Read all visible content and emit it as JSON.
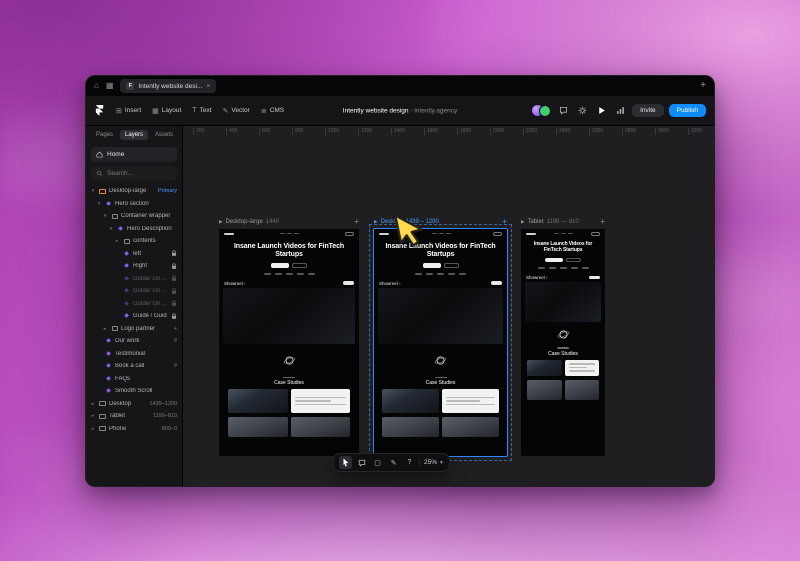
{
  "browser": {
    "tab_title": "Intently website desi...",
    "close_label": "×",
    "new_tab_label": "+"
  },
  "toolbar": {
    "menu": [
      {
        "label": "Insert",
        "icon": "⊞"
      },
      {
        "label": "Layout",
        "icon": "▦"
      },
      {
        "label": "Text",
        "icon": "T"
      },
      {
        "label": "Vector",
        "icon": "✎"
      },
      {
        "label": "CMS",
        "icon": "≣"
      }
    ],
    "title": "Intently website design",
    "separator": "-",
    "subtitle": "intently.agency",
    "invite_label": "Invite",
    "publish_label": "Publish",
    "accent_color": "#0e8cff"
  },
  "sidebar": {
    "tabs": [
      "Pages",
      "Layers",
      "Assets"
    ],
    "active_tab": "Layers",
    "home_label": "Home",
    "search_placeholder": "Search...",
    "tree": [
      {
        "depth": 0,
        "chevron": "down",
        "icon": "breakpoint",
        "primary": true,
        "label": "Desktop-large",
        "right": "Primary",
        "right_accent": true
      },
      {
        "depth": 1,
        "chevron": "down",
        "icon": "component",
        "label": "Hero section"
      },
      {
        "depth": 2,
        "chevron": "down",
        "icon": "frame",
        "label": "Container wrapper"
      },
      {
        "depth": 3,
        "chevron": "down",
        "icon": "component",
        "label": "Hero Description"
      },
      {
        "depth": 4,
        "chevron": "right",
        "icon": "frame",
        "label": "contents"
      },
      {
        "depth": 4,
        "chevron": "",
        "icon": "component",
        "label": "left",
        "lock": true
      },
      {
        "depth": 4,
        "chevron": "",
        "icon": "component",
        "label": "Right",
        "lock": true
      },
      {
        "depth": 4,
        "chevron": "",
        "icon": "component",
        "label": "Guide/ Grid Dot 1",
        "dim": true,
        "lock": true
      },
      {
        "depth": 4,
        "chevron": "",
        "icon": "component",
        "label": "Guide/ Grid Dot 1",
        "dim": true,
        "lock": true
      },
      {
        "depth": 4,
        "chevron": "",
        "icon": "component",
        "label": "Guide/ Grid Dot 1",
        "dim": true,
        "lock": true
      },
      {
        "depth": 4,
        "chevron": "",
        "icon": "component",
        "label": "Guide / Guid",
        "lock": true
      },
      {
        "depth": 2,
        "chevron": "right",
        "icon": "frame",
        "label": "Logo partner",
        "right": "+"
      },
      {
        "depth": 1,
        "chevron": "",
        "icon": "component",
        "label": "Our work",
        "right": "#"
      },
      {
        "depth": 1,
        "chevron": "",
        "icon": "component",
        "label": "Testimonial"
      },
      {
        "depth": 1,
        "chevron": "",
        "icon": "component",
        "label": "Book a call",
        "right": "#"
      },
      {
        "depth": 1,
        "chevron": "",
        "icon": "component",
        "label": "FAQs"
      },
      {
        "depth": 1,
        "chevron": "",
        "icon": "component",
        "label": "Smooth Scroll"
      },
      {
        "depth": 0,
        "chevron": "right",
        "icon": "breakpoint",
        "label": "Desktop",
        "right": "1439–1200"
      },
      {
        "depth": 0,
        "chevron": "right",
        "icon": "breakpoint",
        "label": "Tablet",
        "right": "1199–810"
      },
      {
        "depth": 0,
        "chevron": "right",
        "icon": "breakpoint",
        "label": "Phone",
        "right": "809–0"
      }
    ]
  },
  "canvas": {
    "ruler_labels": [
      "200",
      "400",
      "600",
      "800",
      "1000",
      "1200",
      "1400",
      "1600",
      "1800",
      "2000",
      "2200",
      "2400",
      "2600",
      "2800",
      "3000",
      "3200"
    ],
    "frames": [
      {
        "name": "Desktop-large",
        "size": "1440",
        "selected": false,
        "add_label": "+"
      },
      {
        "name": "Desktop",
        "size": "1439 – 1200",
        "selected": true,
        "add_label": "+"
      },
      {
        "name": "Tablet",
        "size": "1199 — 810",
        "selected": false,
        "add_label": "+"
      }
    ],
    "site": {
      "heading": "Insane Launch Videos for FinTech Startups",
      "showreel_label": "Showreel ›",
      "case_studies_label": "Case Studies"
    },
    "bottom_toolbar": {
      "zoom_label": "25%",
      "help_label": "?"
    }
  }
}
